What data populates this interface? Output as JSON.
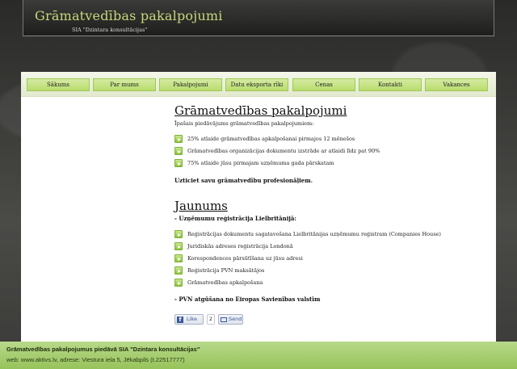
{
  "header": {
    "title": "Grāmatvedības pakalpojumi",
    "subtitle": "SIA \"Dzintara konsultācijas\""
  },
  "nav": {
    "items": [
      {
        "label": "Sākums"
      },
      {
        "label": "Par mums"
      },
      {
        "label": "Pakalpojumi"
      },
      {
        "label": "Datu eksporta rīki"
      },
      {
        "label": "Cenas"
      },
      {
        "label": "Kontakti"
      },
      {
        "label": "Vakances"
      }
    ]
  },
  "section1": {
    "heading": "Grāmatvedības pakalpojumi",
    "intro": "Īpašais piedāvājums grāmatvedības pakalpojumiem:",
    "bullets": [
      "25% atlaide grāmatvedības apkalpošanai pirmajos 12 mēnešos",
      "Grāmatvedības organizācijas dokumentu izstrāde ar atlaidi līdz pat 90%",
      "75% atlaide jūsu pirmajam uzņēmuma gada pārskatam"
    ],
    "tagline": "Uzticiet savu grāmatvedību profesionāļiem."
  },
  "section2": {
    "heading": "Jaunums",
    "subheading": "- Uzņēmumu reģistrācija Lielbritānijā:",
    "bullets": [
      "Reģistrācijas dokumentu sagatavošana Lielbritānijas uzņēmumu reģistram (Companies House)",
      "Juridiskās adreses reģistrācija Londonā",
      "Korespondences pārsūtīšana uz jūsu adresi",
      "Reģistrācija PVN maksātājos",
      "Grāmatvedības apkalpošana"
    ],
    "footnote": "- PVN atgūšana no Eiropas Savienības valstīm"
  },
  "social": {
    "like_label": "Like",
    "like_count": "2",
    "send_label": "Send"
  },
  "footer": {
    "line1": "Grāmatvedības pakalpojumus piedāvā SIA \"Dzintara konsultācijas\"",
    "line2": "web: www.aktivs.lv, adrese: Viestura iela 5, Jēkabpils (t.22517777)"
  },
  "colors": {
    "accent": "#b8dc6c",
    "title": "#c9d77a",
    "footer": "#a9cf76"
  }
}
